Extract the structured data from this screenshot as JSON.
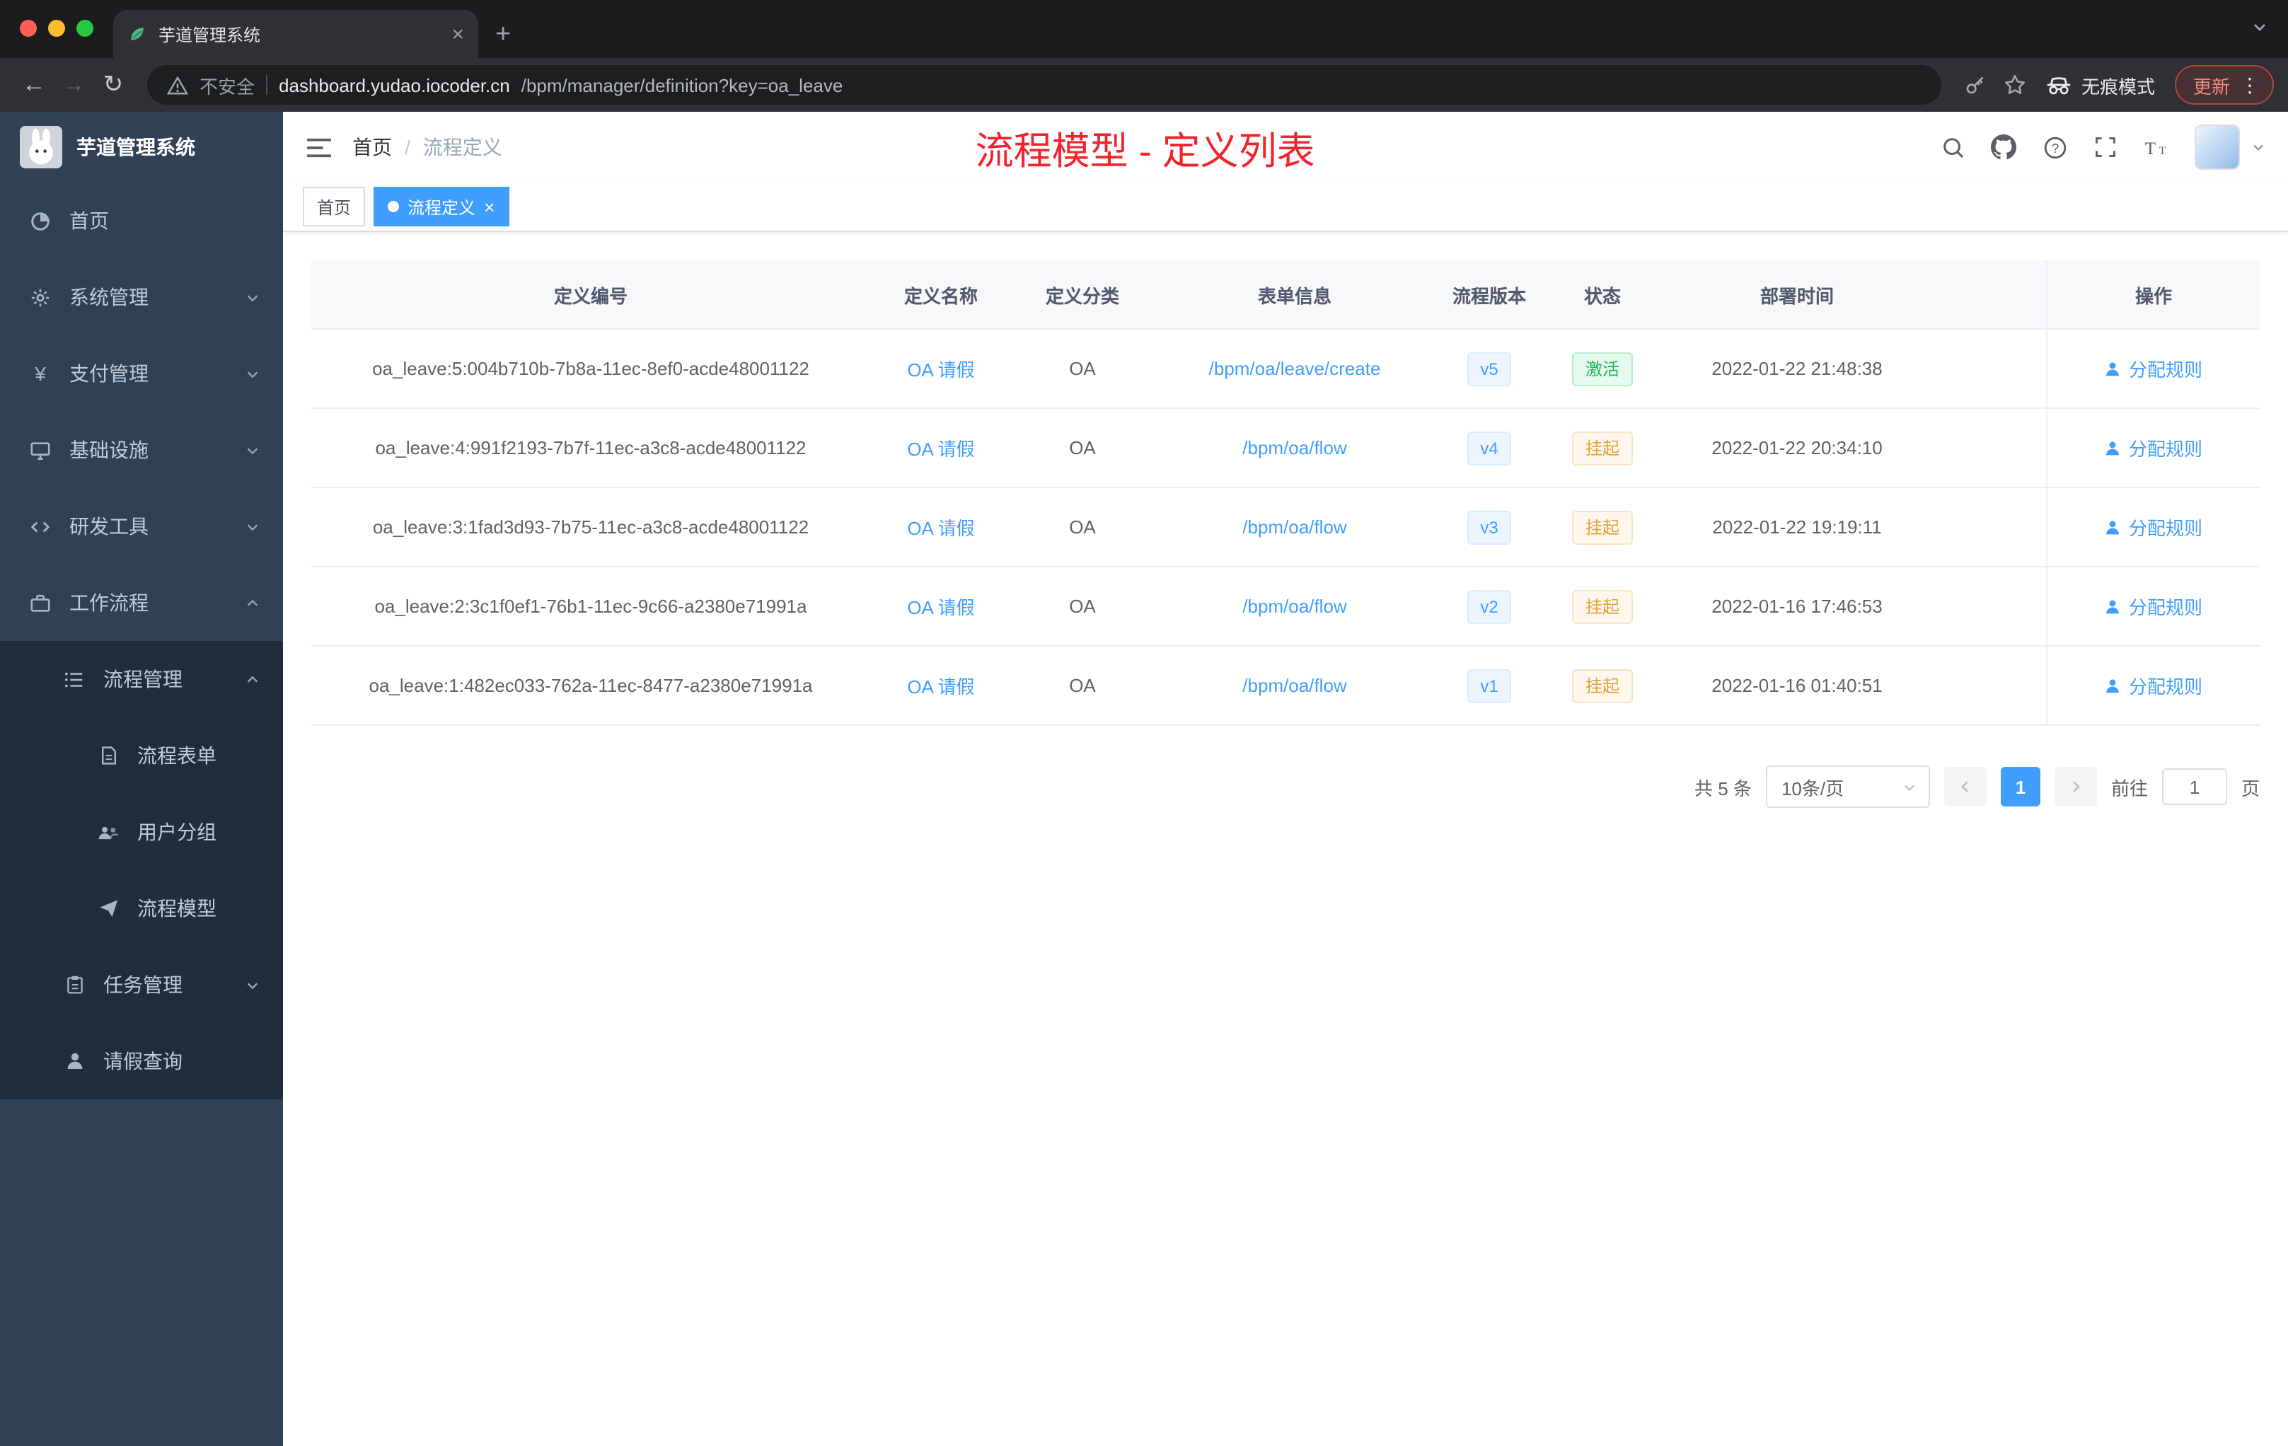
{
  "browser": {
    "tab_title": "芋道管理系统",
    "security_label": "不安全",
    "url_host": "dashboard.yudao.iocoder.cn",
    "url_path": "/bpm/manager/definition?key=oa_leave",
    "incognito_label": "无痕模式",
    "update_label": "更新"
  },
  "sidebar": {
    "brand": "芋道管理系统",
    "items": {
      "home": "首页",
      "system": "系统管理",
      "payment": "支付管理",
      "infra": "基础设施",
      "devtools": "研发工具",
      "workflow": "工作流程",
      "process_mgmt": "流程管理",
      "process_form": "流程表单",
      "user_group": "用户分组",
      "process_model": "流程模型",
      "task_mgmt": "任务管理",
      "leave_query": "请假查询"
    }
  },
  "header": {
    "breadcrumb_home": "首页",
    "breadcrumb_sep": "/",
    "breadcrumb_current": "流程定义",
    "annotation": "流程模型 - 定义列表"
  },
  "tags_view": {
    "home_tag": "首页",
    "active_tag": "流程定义"
  },
  "table": {
    "columns": {
      "id": "定义编号",
      "name": "定义名称",
      "category": "定义分类",
      "form": "表单信息",
      "version": "流程版本",
      "status": "状态",
      "deploy_time": "部署时间",
      "action": "操作"
    },
    "rows": [
      {
        "id": "oa_leave:5:004b710b-7b8a-11ec-8ef0-acde48001122",
        "name": "OA 请假",
        "category": "OA",
        "form": "/bpm/oa/leave/create",
        "version": "v5",
        "status": "激活",
        "status_type": "success",
        "time": "2022-01-22 21:48:38",
        "action": "分配规则"
      },
      {
        "id": "oa_leave:4:991f2193-7b7f-11ec-a3c8-acde48001122",
        "name": "OA 请假",
        "category": "OA",
        "form": "/bpm/oa/flow",
        "version": "v4",
        "status": "挂起",
        "status_type": "warning",
        "time": "2022-01-22 20:34:10",
        "action": "分配规则"
      },
      {
        "id": "oa_leave:3:1fad3d93-7b75-11ec-a3c8-acde48001122",
        "name": "OA 请假",
        "category": "OA",
        "form": "/bpm/oa/flow",
        "version": "v3",
        "status": "挂起",
        "status_type": "warning",
        "time": "2022-01-22 19:19:11",
        "action": "分配规则"
      },
      {
        "id": "oa_leave:2:3c1f0ef1-76b1-11ec-9c66-a2380e71991a",
        "name": "OA 请假",
        "category": "OA",
        "form": "/bpm/oa/flow",
        "version": "v2",
        "status": "挂起",
        "status_type": "warning",
        "time": "2022-01-16 17:46:53",
        "action": "分配规则"
      },
      {
        "id": "oa_leave:1:482ec033-762a-11ec-8477-a2380e71991a",
        "name": "OA 请假",
        "category": "OA",
        "form": "/bpm/oa/flow",
        "version": "v1",
        "status": "挂起",
        "status_type": "warning",
        "time": "2022-01-16 01:40:51",
        "action": "分配规则"
      }
    ]
  },
  "pagination": {
    "total": "共 5 条",
    "page_size": "10条/页",
    "current_page": "1",
    "goto_label": "前往",
    "goto_value": "1",
    "page_unit": "页"
  },
  "colors": {
    "accent_blue": "#409eff",
    "success_green": "#1fb65c",
    "warning_orange": "#e6a23c",
    "annotation_red": "#f5222d",
    "sidebar_bg": "#304156",
    "submenu_bg": "#1f2d3d"
  }
}
